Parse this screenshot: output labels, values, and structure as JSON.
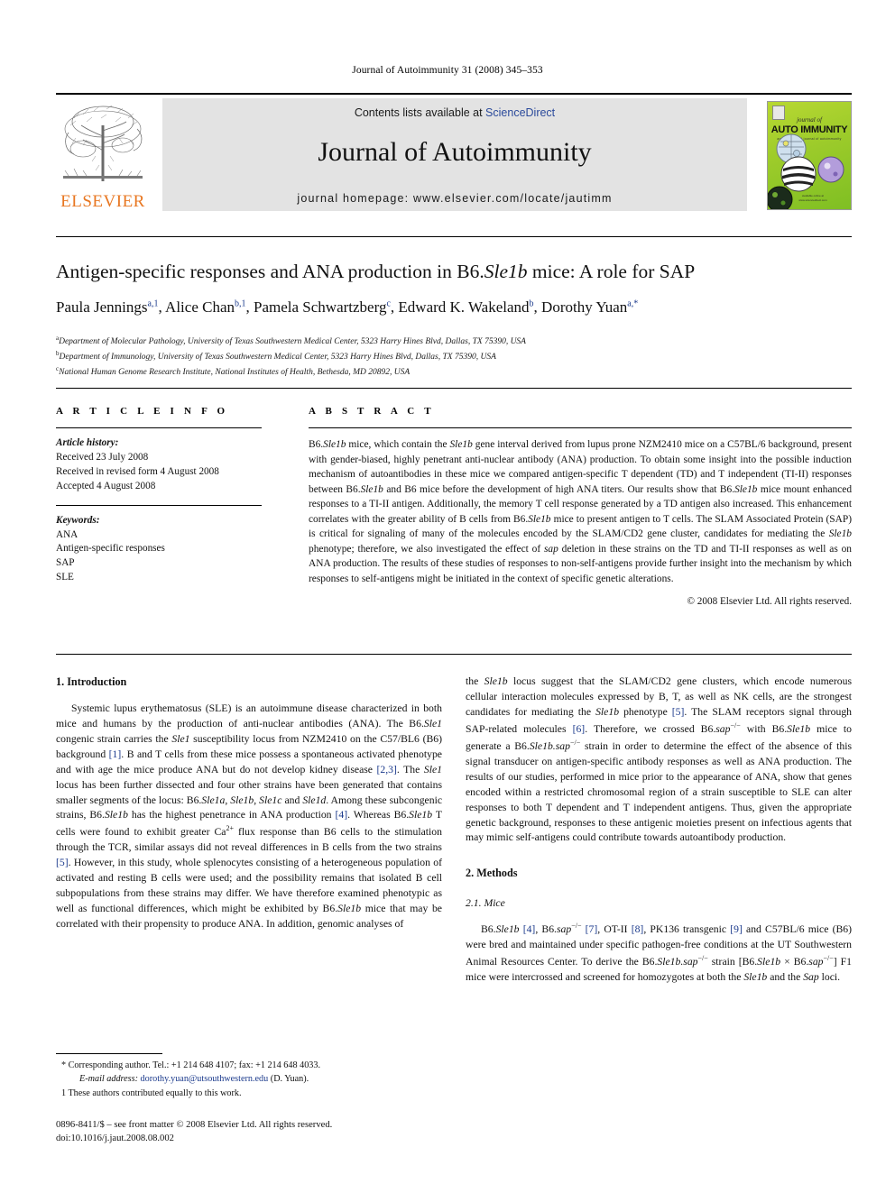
{
  "running_head": "Journal of Autoimmunity 31 (2008) 345–353",
  "masthead": {
    "elsevier_wordmark": "ELSEVIER",
    "contents_prefix": "Contents lists available at ",
    "sciencedirect": "ScienceDirect",
    "journal_title": "Journal of Autoimmunity",
    "homepage": "journal homepage: www.elsevier.com/locate/jautimm",
    "cover": {
      "journal_of": "journal of",
      "auto": "AUTO IMMUNITY",
      "subtitle": "an international journal of autoimmunity"
    },
    "accent_orange": "#E87722",
    "link_blue": "#2b4a9b",
    "banner_bg": "#e3e3e3",
    "cover_green": "#9ccb2a"
  },
  "article": {
    "title_pre": "Antigen-specific responses and ANA production in B6.",
    "title_italic": "Sle1b",
    "title_post": " mice: A role for SAP",
    "authors": [
      {
        "name": "Paula Jennings",
        "sup": "a,1",
        "sep": ", "
      },
      {
        "name": "Alice Chan",
        "sup": "b,1",
        "sep": ", "
      },
      {
        "name": "Pamela Schwartzberg",
        "sup": "c",
        "sep": ", "
      },
      {
        "name": "Edward K. Wakeland",
        "sup": "b",
        "sep": ", "
      },
      {
        "name": "Dorothy Yuan",
        "sup": "a,*",
        "sep": ""
      }
    ],
    "affiliations": [
      {
        "mark": "a",
        "text": "Department of Molecular Pathology, University of Texas Southwestern Medical Center, 5323 Harry Hines Blvd, Dallas, TX 75390, USA"
      },
      {
        "mark": "b",
        "text": "Department of Immunology, University of Texas Southwestern Medical Center, 5323 Harry Hines Blvd, Dallas, TX 75390, USA"
      },
      {
        "mark": "c",
        "text": "National Human Genome Research Institute, National Institutes of Health, Bethesda, MD 20892, USA"
      }
    ]
  },
  "article_info": {
    "heading": "A R T I C L E  I N F O",
    "history_label": "Article history:",
    "history": [
      "Received 23 July 2008",
      "Received in revised form 4 August 2008",
      "Accepted 4 August 2008"
    ],
    "keywords_label": "Keywords:",
    "keywords": [
      "ANA",
      "Antigen-specific responses",
      "SAP",
      "SLE"
    ]
  },
  "abstract": {
    "heading": "A B S T R A C T",
    "copyright": "© 2008 Elsevier Ltd. All rights reserved."
  },
  "sections": {
    "intro_heading": "1. Introduction",
    "methods_heading": "2. Methods",
    "mice_heading": "2.1. Mice"
  },
  "footnotes": {
    "corresponding": "* Corresponding author. Tel.: +1 214 648 4107; fax: +1 214 648 4033.",
    "email_label": "E-mail address:",
    "email": "dorothy.yuan@utsouthwestern.edu",
    "email_suffix": " (D. Yuan).",
    "equal_contrib": "1 These authors contributed equally to this work."
  },
  "imprint": {
    "line1": "0896-8411/$ – see front matter © 2008 Elsevier Ltd. All rights reserved.",
    "line2": "doi:10.1016/j.jaut.2008.08.002"
  }
}
